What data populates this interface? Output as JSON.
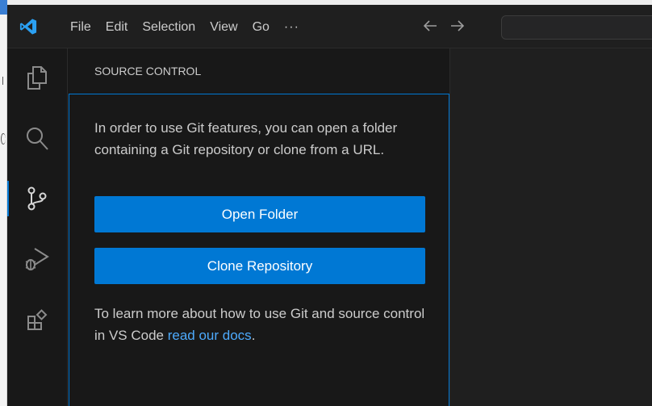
{
  "menu": {
    "items": [
      "File",
      "Edit",
      "Selection",
      "View",
      "Go"
    ],
    "more": "···"
  },
  "activity_bar": {
    "items": [
      {
        "name": "explorer",
        "icon": "files-icon"
      },
      {
        "name": "search",
        "icon": "search-icon"
      },
      {
        "name": "source-control",
        "icon": "source-control-icon",
        "active": true
      },
      {
        "name": "run-and-debug",
        "icon": "run-debug-icon"
      },
      {
        "name": "extensions",
        "icon": "extensions-icon"
      }
    ]
  },
  "sidebar": {
    "title": "SOURCE CONTROL",
    "message": "In order to use Git features, you can open a folder containing a Git repository or clone from a URL.",
    "open_folder_label": "Open Folder",
    "clone_repo_label": "Clone Repository",
    "learn_more_prefix": "To learn more about how to use Git and source control in VS Code ",
    "learn_more_link": "read our docs",
    "learn_more_suffix": "."
  },
  "colors": {
    "accent": "#0078d4",
    "link": "#4daafc",
    "background": "#181818",
    "text": "#cccccc"
  }
}
